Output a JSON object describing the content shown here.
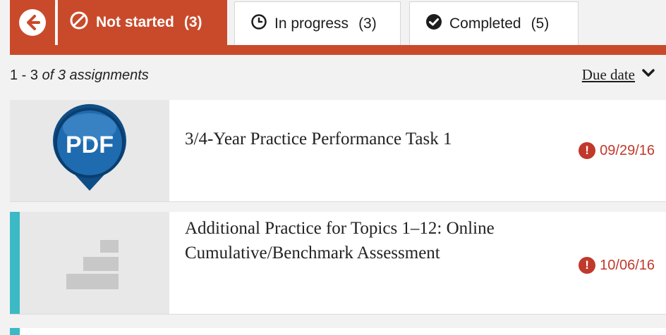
{
  "tabs": {
    "back_label": "",
    "not_started": {
      "label": "Not started",
      "count": "(3)"
    },
    "in_progress": {
      "label": "In progress",
      "count": "(3)"
    },
    "completed": {
      "label": "Completed",
      "count": "(5)"
    }
  },
  "summary": {
    "range": "1 - 3",
    "of_text": "of 3 assignments"
  },
  "sort": {
    "label": "Due date"
  },
  "assignments": [
    {
      "title": "3/4-Year Practice Performance Task 1",
      "due": "09/29/16",
      "thumb_icon": "pdf-icon",
      "thumb_text": "PDF"
    },
    {
      "title": "Additional Practice for Topics 1–12: Online Cumulative/Benchmark Assessment",
      "due": "10/06/16",
      "thumb_icon": "assessment-steps-icon"
    }
  ],
  "colors": {
    "accent": "#c94a2a",
    "overdue": "#c0392b",
    "teal": "#3bbac6"
  }
}
